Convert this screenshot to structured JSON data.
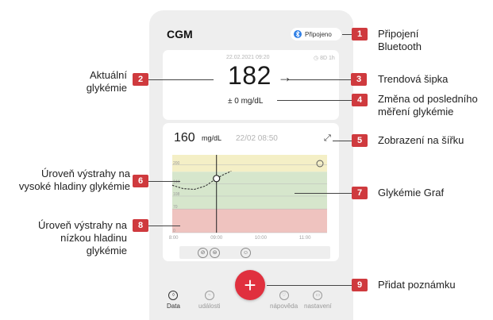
{
  "app": {
    "title": "CGM",
    "bluetooth_status": "Připojeno",
    "current_reading": {
      "date": "22.02.2021 09:20",
      "duration": "8D 1h",
      "value": "182",
      "trend_arrow": "→",
      "delta": "± 0 mg/dL"
    },
    "graph_card": {
      "value": "160",
      "unit": "mg/dL",
      "time": "22/02 08:50",
      "y_ticks": [
        "200",
        "144",
        "108",
        "70",
        "0"
      ],
      "x_ticks": [
        "08:00",
        "09:00",
        "10:00",
        "11:00"
      ]
    },
    "nav": {
      "items": [
        {
          "label": "Data"
        },
        {
          "label": "události"
        },
        {
          "label": "nápověda"
        },
        {
          "label": "nastavení"
        }
      ]
    },
    "fab_symbol": "+"
  },
  "annotations": {
    "c1": {
      "num": "1",
      "line1": "Připojení",
      "line2": "Bluetooth"
    },
    "c2": {
      "num": "2",
      "line1": "Aktuální",
      "line2": "glykémie"
    },
    "c3": {
      "num": "3",
      "line1": "Trendová šipka"
    },
    "c4": {
      "num": "4",
      "line1": "Změna od posledního",
      "line2": "měření glykémie"
    },
    "c5": {
      "num": "5",
      "line1": "Zobrazení na šířku"
    },
    "c6": {
      "num": "6",
      "line1": "Úroveň výstrahy na",
      "line2": "vysoké hladiny glykémie"
    },
    "c7": {
      "num": "7",
      "line1": "Glykémie Graf"
    },
    "c8": {
      "num": "8",
      "line1": "Úroveň výstrahy na",
      "line2": "nízkou hladinu",
      "line3": "glykémie"
    },
    "c9": {
      "num": "9",
      "line1": "Přidat poznámku"
    }
  },
  "colors": {
    "accent_red": "#e0303e",
    "badge_red": "#cf3a3e",
    "high_zone": "#f4efc6",
    "target_zone": "#d6e6cc",
    "low_zone": "#efc3bf",
    "bluetooth_blue": "#2f7fe6"
  },
  "chart_data": {
    "type": "line",
    "x_range": [
      "08:00",
      "11:30"
    ],
    "ylim": [
      0,
      230
    ],
    "x_ticks": [
      "08:00",
      "09:00",
      "10:00",
      "11:00"
    ],
    "y_ticks": [
      0,
      70,
      108,
      144,
      200
    ],
    "high_alert_level": 200,
    "target_range": [
      70,
      180
    ],
    "low_alert_level": 70,
    "series": [
      {
        "x": [
          "08:00",
          "08:15",
          "08:30",
          "08:45",
          "09:00",
          "09:10",
          "09:20"
        ],
        "y": [
          140,
          130,
          128,
          138,
          160,
          172,
          182
        ]
      }
    ],
    "cursor_time": "09:00"
  }
}
